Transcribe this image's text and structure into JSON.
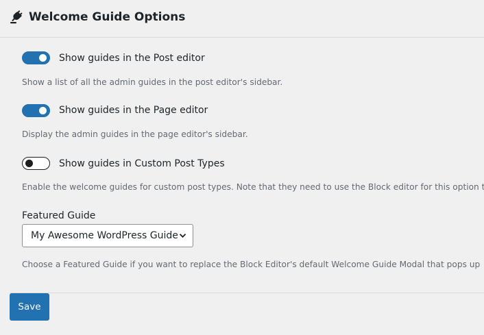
{
  "header": {
    "icon": "admin-plugins-icon",
    "title": "Welcome Guide Options"
  },
  "options": [
    {
      "label": "Show guides in the Post editor",
      "enabled": true,
      "help": "Show a list of all the admin guides in the post editor's sidebar."
    },
    {
      "label": "Show guides in the Page editor",
      "enabled": true,
      "help": "Display the admin guides in the page editor's sidebar."
    },
    {
      "label": "Show guides in Custom Post Types",
      "enabled": false,
      "help": "Enable the welcome guides for custom post types. Note that they need to use the Block editor for this option t"
    }
  ],
  "featured": {
    "label": "Featured Guide",
    "selected": "My Awesome WordPress Guide",
    "help": "Choose a Featured Guide if you want to replace the Block Editor's default Welcome Guide Modal that pops up"
  },
  "save_label": "Save",
  "colors": {
    "accent": "#2271b1",
    "background": "#f0f0f1",
    "help_text": "#646970"
  }
}
